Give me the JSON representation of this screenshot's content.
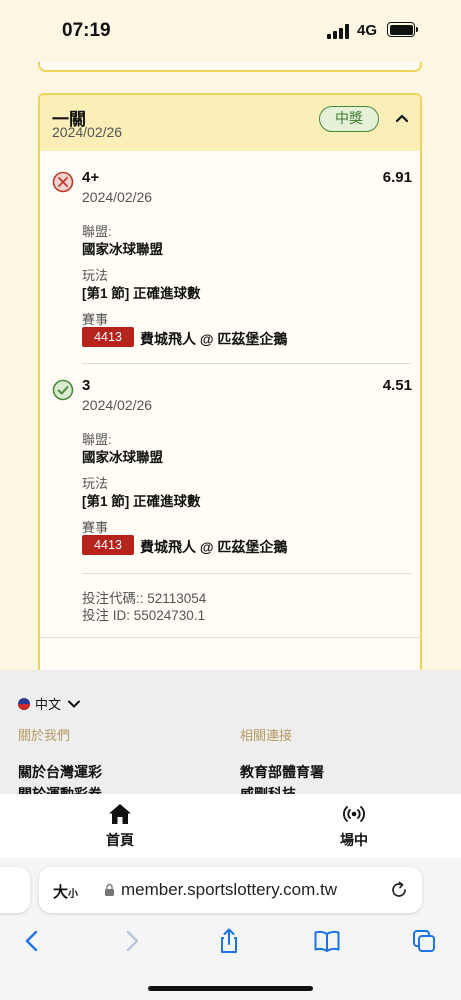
{
  "status_bar": {
    "time": "07:19",
    "network": "4G"
  },
  "card": {
    "title": "一關",
    "date": "2024/02/26",
    "result_badge": "中獎",
    "legs": [
      {
        "status": "lost",
        "pick": "4+",
        "date": "2024/02/26",
        "odds": "6.91",
        "league_label": "聯盟:",
        "league": "國家冰球聯盟",
        "market_label": "玩法",
        "market": "[第1 節] 正確進球數",
        "event_label": "賽事",
        "event_code": "4413",
        "event": "費城飛人 @ 匹茲堡企鵝"
      },
      {
        "status": "won",
        "pick": "3",
        "date": "2024/02/26",
        "odds": "4.51",
        "league_label": "聯盟:",
        "league": "國家冰球聯盟",
        "market_label": "玩法",
        "market": "[第1 節] 正確進球數",
        "event_label": "賽事",
        "event_code": "4413",
        "event": "費城飛人 @ 匹茲堡企鵝"
      }
    ],
    "bet_code": "投注代碼:: 52113054",
    "bet_id": "投注 ID: 55024730.1"
  },
  "footer": {
    "language": "中文",
    "col1_heading": "關於我們",
    "col2_heading": "相關連接",
    "col1_links": [
      "關於台灣運彩",
      "關於運動彩券"
    ],
    "col2_links": [
      "教育部體育署",
      "威剛科技"
    ]
  },
  "tabbar": {
    "home": "首頁",
    "live": "場中"
  },
  "browser": {
    "text_size_big": "大",
    "text_size_small": "小",
    "url": "member.sportslottery.com.tw"
  },
  "colors": {
    "card_border": "#f0d35a",
    "header_bg": "#fbeeb7",
    "win_green": "#4a8a3c",
    "loss_red": "#c0392b",
    "event_code_bg": "#b5231c"
  }
}
